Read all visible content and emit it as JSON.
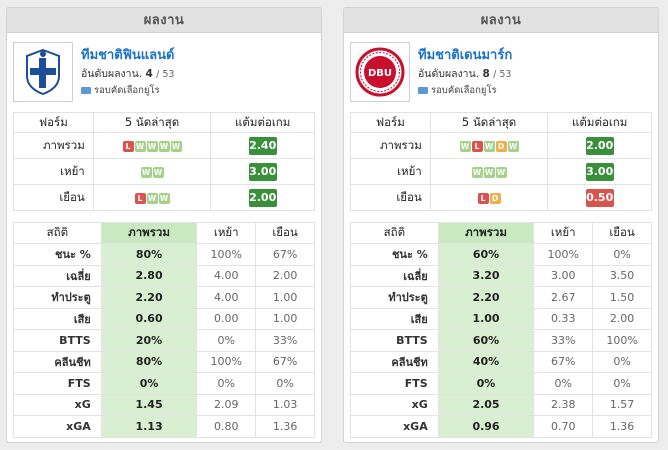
{
  "left": {
    "header": "ผลงาน",
    "team_name": "ทีมชาติฟินแลนด์",
    "rank_label": "อันดับผลงาน.",
    "rank": "4",
    "rank_total": "/ 53",
    "competition": "รอบคัดเลือกยูโร",
    "crest_icon": "finland-crest-icon",
    "form_headers": [
      "ฟอร์ม",
      "5 นัดล่าสุด",
      "แต้มต่อเกม"
    ],
    "form_rows": [
      {
        "label": "ภาพรวม",
        "results": [
          "L",
          "W",
          "W",
          "W",
          "W"
        ],
        "ppg": "2.40",
        "ppg_color": "green"
      },
      {
        "label": "เหย้า",
        "results": [
          "W",
          "W"
        ],
        "ppg": "3.00",
        "ppg_color": "green"
      },
      {
        "label": "เยือน",
        "results": [
          "L",
          "W",
          "W"
        ],
        "ppg": "2.00",
        "ppg_color": "green"
      }
    ],
    "stats_headers": [
      "สถิติ",
      "ภาพรวม",
      "เหย้า",
      "เยือน"
    ],
    "stats_rows": [
      {
        "label": "ชนะ %",
        "overall": "80%",
        "home": "100%",
        "away": "67%"
      },
      {
        "label": "เฉลี่ย",
        "overall": "2.80",
        "home": "4.00",
        "away": "2.00"
      },
      {
        "label": "ทำประตู",
        "overall": "2.20",
        "home": "4.00",
        "away": "1.00"
      },
      {
        "label": "เสีย",
        "overall": "0.60",
        "home": "0.00",
        "away": "1.00"
      },
      {
        "label": "BTTS",
        "overall": "20%",
        "home": "0%",
        "away": "33%"
      },
      {
        "label": "คลีนชีท",
        "overall": "80%",
        "home": "100%",
        "away": "67%"
      },
      {
        "label": "FTS",
        "overall": "0%",
        "home": "0%",
        "away": "0%"
      },
      {
        "label": "xG",
        "overall": "1.45",
        "home": "2.09",
        "away": "1.03"
      },
      {
        "label": "xGA",
        "overall": "1.13",
        "home": "0.80",
        "away": "1.36"
      }
    ]
  },
  "right": {
    "header": "ผลงาน",
    "team_name": "ทีมชาติเดนมาร์ก",
    "rank_label": "อันดับผลงาน.",
    "rank": "8",
    "rank_total": "/ 53",
    "competition": "รอบคัดเลือกยูโร",
    "crest_icon": "denmark-crest-icon",
    "crest_text": "DBU",
    "form_headers": [
      "ฟอร์ม",
      "5 นัดล่าสุด",
      "แต้มต่อเกม"
    ],
    "form_rows": [
      {
        "label": "ภาพรวม",
        "results": [
          "W",
          "L",
          "W",
          "D",
          "W"
        ],
        "ppg": "2.00",
        "ppg_color": "green"
      },
      {
        "label": "เหย้า",
        "results": [
          "W",
          "W",
          "W"
        ],
        "ppg": "3.00",
        "ppg_color": "green"
      },
      {
        "label": "เยือน",
        "results": [
          "L",
          "D"
        ],
        "ppg": "0.50",
        "ppg_color": "red"
      }
    ],
    "stats_headers": [
      "สถิติ",
      "ภาพรวม",
      "เหย้า",
      "เยือน"
    ],
    "stats_rows": [
      {
        "label": "ชนะ %",
        "overall": "60%",
        "home": "100%",
        "away": "0%"
      },
      {
        "label": "เฉลี่ย",
        "overall": "3.20",
        "home": "3.00",
        "away": "3.50"
      },
      {
        "label": "ทำประตู",
        "overall": "2.20",
        "home": "2.67",
        "away": "1.50"
      },
      {
        "label": "เสีย",
        "overall": "1.00",
        "home": "0.33",
        "away": "2.00"
      },
      {
        "label": "BTTS",
        "overall": "60%",
        "home": "33%",
        "away": "100%"
      },
      {
        "label": "คลีนชีท",
        "overall": "40%",
        "home": "67%",
        "away": "0%"
      },
      {
        "label": "FTS",
        "overall": "0%",
        "home": "0%",
        "away": "0%"
      },
      {
        "label": "xG",
        "overall": "2.05",
        "home": "2.38",
        "away": "1.57"
      },
      {
        "label": "xGA",
        "overall": "0.96",
        "home": "0.70",
        "away": "1.36"
      }
    ]
  }
}
